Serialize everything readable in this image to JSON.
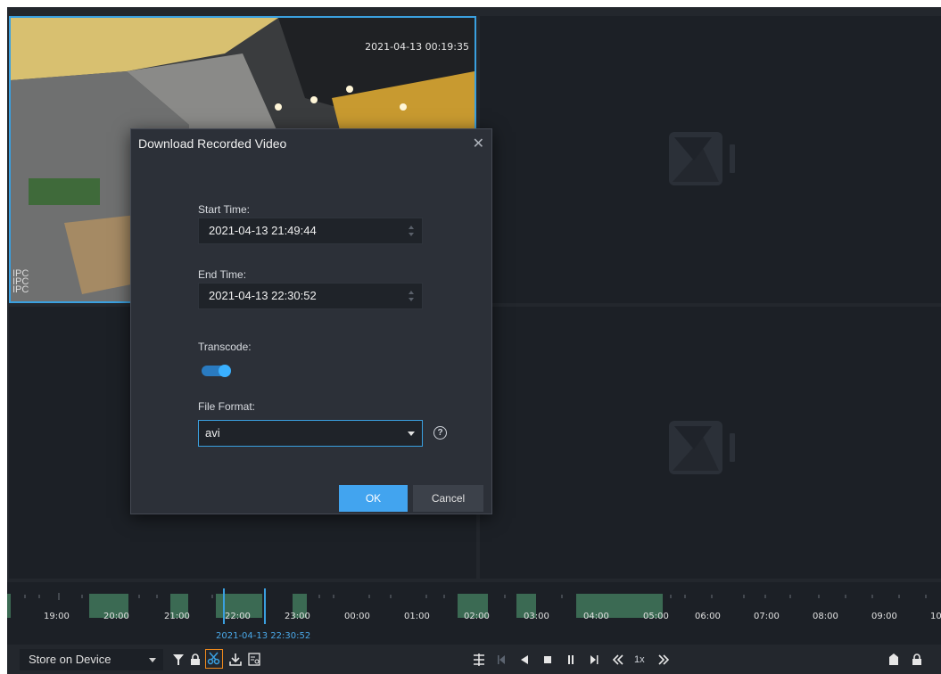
{
  "video": {
    "timestamp": "2021-04-13 00:19:35",
    "overlay_labels": [
      "IPC",
      "IPC",
      "IPC"
    ]
  },
  "dialog": {
    "title": "Download Recorded Video",
    "start_label": "Start Time:",
    "start_value": "2021-04-13 21:49:44",
    "end_label": "End Time:",
    "end_value": "2021-04-13 22:30:52",
    "transcode_label": "Transcode:",
    "transcode_on": true,
    "format_label": "File Format:",
    "format_value": "avi",
    "ok_label": "OK",
    "cancel_label": "Cancel"
  },
  "timeline": {
    "hours": [
      "19:00",
      "20:00",
      "21:00",
      "22:00",
      "23:00",
      "00:00",
      "01:00",
      "02:00",
      "03:00",
      "04:00",
      "05:00",
      "06:00",
      "07:00",
      "08:00",
      "09:00",
      "10"
    ],
    "current_time": "2021-04-13 22:30:52"
  },
  "toolbar": {
    "storage_select": "Store on Device",
    "speed": "1x"
  },
  "colors": {
    "accent": "#42a4ef",
    "record": "#3b6a53",
    "bg": "#1c2026"
  }
}
